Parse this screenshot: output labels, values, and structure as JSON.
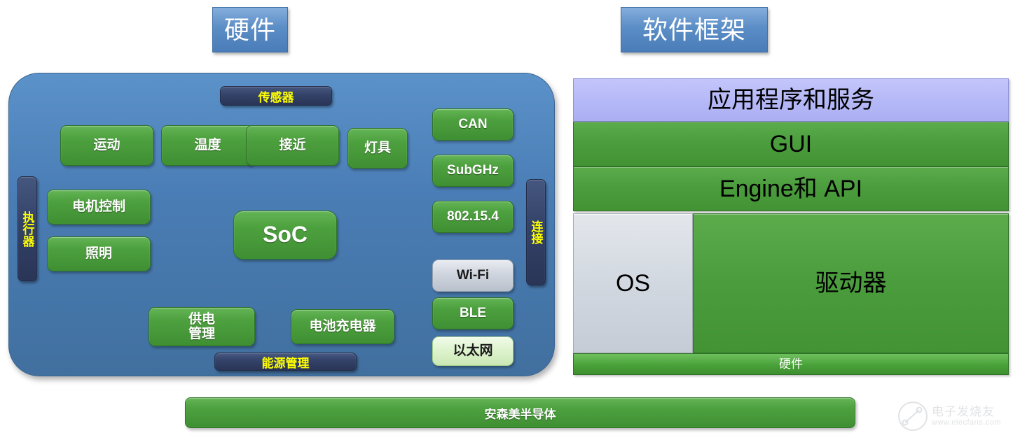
{
  "titles": {
    "hardware": "硬件",
    "software": "软件框架"
  },
  "hardware": {
    "sensors_label": "传感器",
    "actuators_label": "执行器",
    "connectivity_label": "连接",
    "energy_label": "能源管理",
    "soc": "SoC",
    "sensors": [
      {
        "label": "运动"
      },
      {
        "label": "温度"
      },
      {
        "label": "接近"
      },
      {
        "label": "灯具"
      }
    ],
    "actuators": [
      {
        "label": "电机控制"
      },
      {
        "label": "照明"
      }
    ],
    "connectivity": [
      {
        "label": "CAN",
        "style": "green"
      },
      {
        "label": "SubGHz",
        "style": "green"
      },
      {
        "label": "802.15.4",
        "style": "green"
      },
      {
        "label": "Wi-Fi",
        "style": "silver"
      },
      {
        "label": "BLE",
        "style": "green"
      },
      {
        "label": "以太网",
        "style": "pale"
      }
    ],
    "power": [
      {
        "label": "供电\n管理"
      },
      {
        "label": "电池充电器"
      }
    ]
  },
  "software": {
    "layers": [
      {
        "label": "应用程序和服务",
        "style": "purple"
      },
      {
        "label": "GUI",
        "style": "green"
      },
      {
        "label": "Engine和 API",
        "style": "green"
      },
      {
        "label": "OS",
        "style": "silver"
      },
      {
        "label": "驱动器",
        "style": "green"
      },
      {
        "label": "硬件",
        "style": "green-bar"
      }
    ]
  },
  "brand": {
    "label": "安森美半导体"
  },
  "watermark": {
    "name": "电子发烧友",
    "url": "www.elecfans.com"
  },
  "colors": {
    "panel_blue": "#4a7db5",
    "chip_green": "#4da03e",
    "navy_pill": "#334268",
    "pill_text_yellow": "#ffff00",
    "app_band_purple": "#b5b8f7",
    "os_silver": "#d2d8e0"
  }
}
